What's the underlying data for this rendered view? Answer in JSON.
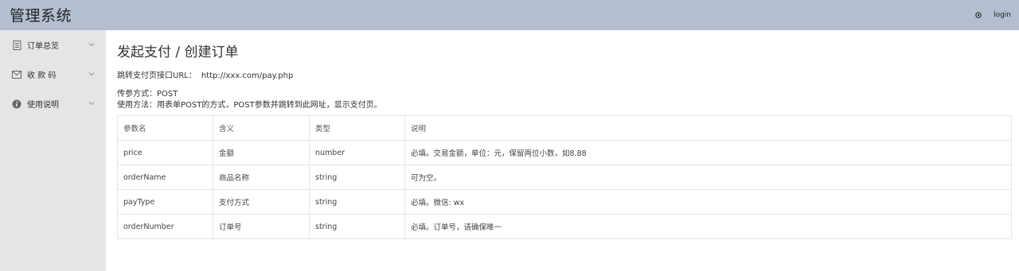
{
  "header": {
    "app_title": "管理系统",
    "login_label": "login"
  },
  "sidebar": {
    "items": [
      {
        "label": "订单总览",
        "icon": "document-icon"
      },
      {
        "label": "收 款 码",
        "icon": "envelope-icon"
      },
      {
        "label": "使用说明",
        "icon": "info-icon"
      }
    ]
  },
  "main": {
    "title": "发起支付 / 创建订单",
    "url_label": "跳转支付页接口URL：",
    "url_value": "http://xxx.com/pay.php",
    "param_method": "传参方式：POST",
    "usage": "使用方法：用表单POST的方式，POST参数并跳转到此网址，显示支付页。",
    "table": {
      "headers": [
        "参数名",
        "含义",
        "类型",
        "说明"
      ],
      "rows": [
        [
          "price",
          "金额",
          "number",
          "必填。交易金额，单位：元，保留两位小数，如8.88"
        ],
        [
          "orderName",
          "商品名称",
          "string",
          "可为空。"
        ],
        [
          "payType",
          "支付方式",
          "string",
          "必填。微信: wx"
        ],
        [
          "orderNumber",
          "订单号",
          "string",
          "必填。订单号，请确保唯一"
        ]
      ]
    }
  },
  "colors": {
    "header_bg": "#b3bfd1",
    "sidebar_bg": "#e5e5e5",
    "table_border": "#e6e6e6"
  }
}
